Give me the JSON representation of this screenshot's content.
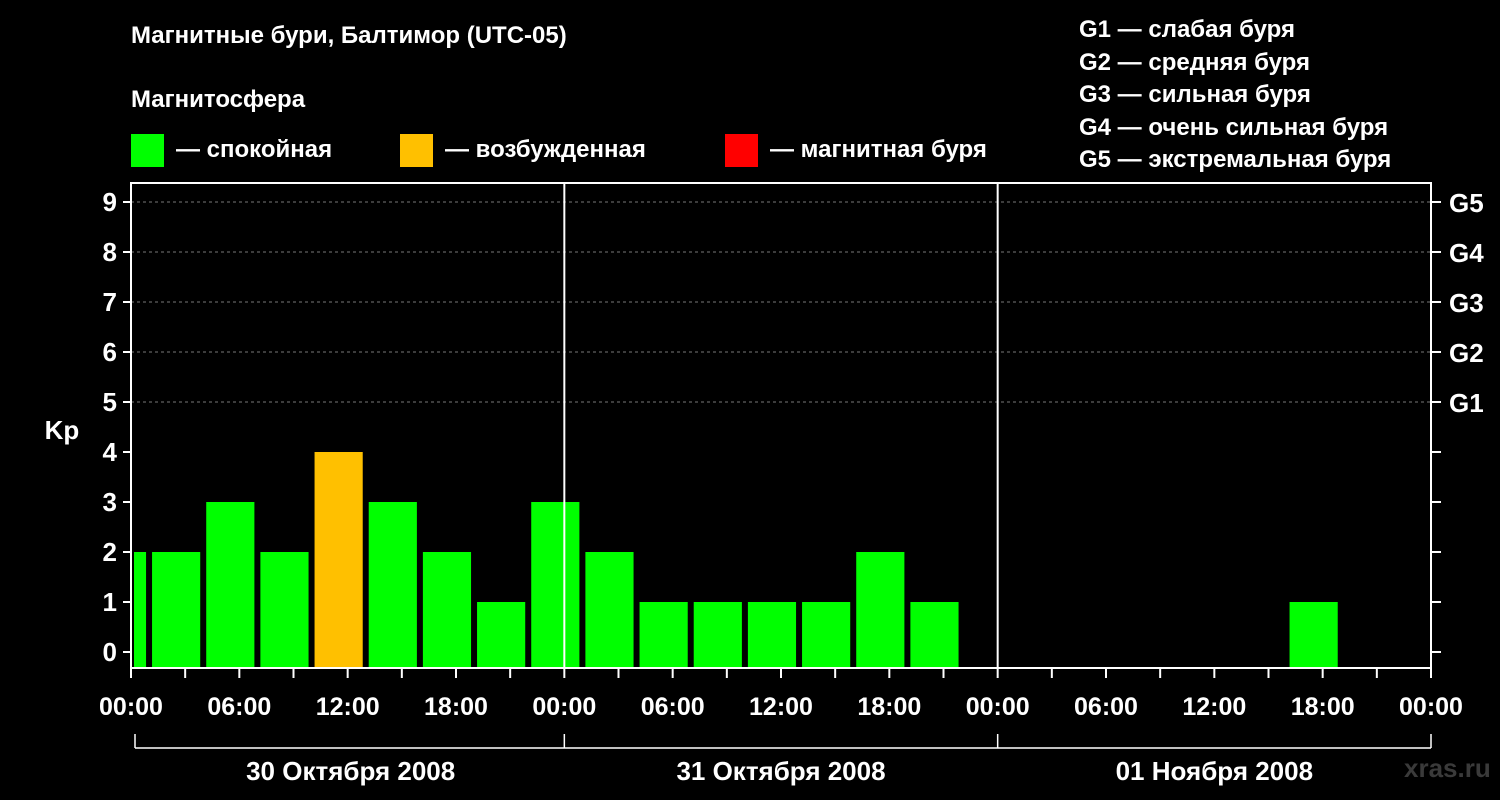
{
  "title": "Магнитные бури, Балтимор (UTC-05)",
  "subtitle": "Магнитосфера",
  "legend": [
    {
      "label": "— спокойная",
      "color": "#00ff00"
    },
    {
      "label": "— возбужденная",
      "color": "#ffc000"
    },
    {
      "label": "— магнитная буря",
      "color": "#ff0000"
    }
  ],
  "g_legend": [
    "G1 — слабая буря",
    "G2 — средняя буря",
    "G3 — сильная буря",
    "G4 — очень сильная буря",
    "G5 — экстремальная буря"
  ],
  "watermark": "xras.ru",
  "chart_data": {
    "type": "bar",
    "ylabel": "Kp",
    "ylim": [
      0,
      9
    ],
    "yticks": [
      "0",
      "1",
      "2",
      "3",
      "4",
      "5",
      "6",
      "7",
      "8",
      "9"
    ],
    "g_levels": [
      {
        "value": 5,
        "label": "G1"
      },
      {
        "value": 6,
        "label": "G2"
      },
      {
        "value": 7,
        "label": "G3"
      },
      {
        "value": 8,
        "label": "G4"
      },
      {
        "value": 9,
        "label": "G5"
      }
    ],
    "x_tick_labels": [
      "00:00",
      "06:00",
      "12:00",
      "18:00",
      "00:00",
      "06:00",
      "12:00",
      "18:00",
      "00:00",
      "06:00",
      "12:00",
      "18:00",
      "00:00"
    ],
    "days": [
      "30 Октября 2008",
      "31 Октября 2008",
      "01 Ноября 2008"
    ],
    "x_unit": "hours since 30 Октября 2008 00:00 (UTC-05)",
    "bars": [
      {
        "start_hour": 0,
        "end_hour": 1,
        "kp": 2,
        "state": "спокойная"
      },
      {
        "start_hour": 1,
        "end_hour": 4,
        "kp": 2,
        "state": "спокойная"
      },
      {
        "start_hour": 4,
        "end_hour": 7,
        "kp": 3,
        "state": "спокойная"
      },
      {
        "start_hour": 7,
        "end_hour": 10,
        "kp": 2,
        "state": "спокойная"
      },
      {
        "start_hour": 10,
        "end_hour": 13,
        "kp": 4,
        "state": "возбужденная"
      },
      {
        "start_hour": 13,
        "end_hour": 16,
        "kp": 3,
        "state": "спокойная"
      },
      {
        "start_hour": 16,
        "end_hour": 19,
        "kp": 2,
        "state": "спокойная"
      },
      {
        "start_hour": 19,
        "end_hour": 22,
        "kp": 1,
        "state": "спокойная"
      },
      {
        "start_hour": 22,
        "end_hour": 25,
        "kp": 3,
        "state": "спокойная"
      },
      {
        "start_hour": 25,
        "end_hour": 28,
        "kp": 2,
        "state": "спокойная"
      },
      {
        "start_hour": 28,
        "end_hour": 31,
        "kp": 1,
        "state": "спокойная"
      },
      {
        "start_hour": 31,
        "end_hour": 34,
        "kp": 1,
        "state": "спокойная"
      },
      {
        "start_hour": 34,
        "end_hour": 37,
        "kp": 1,
        "state": "спокойная"
      },
      {
        "start_hour": 37,
        "end_hour": 40,
        "kp": 1,
        "state": "спокойная"
      },
      {
        "start_hour": 40,
        "end_hour": 43,
        "kp": 2,
        "state": "спокойная"
      },
      {
        "start_hour": 43,
        "end_hour": 46,
        "kp": 1,
        "state": "спокойная"
      },
      {
        "start_hour": 64,
        "end_hour": 67,
        "kp": 1,
        "state": "спокойная"
      }
    ]
  }
}
